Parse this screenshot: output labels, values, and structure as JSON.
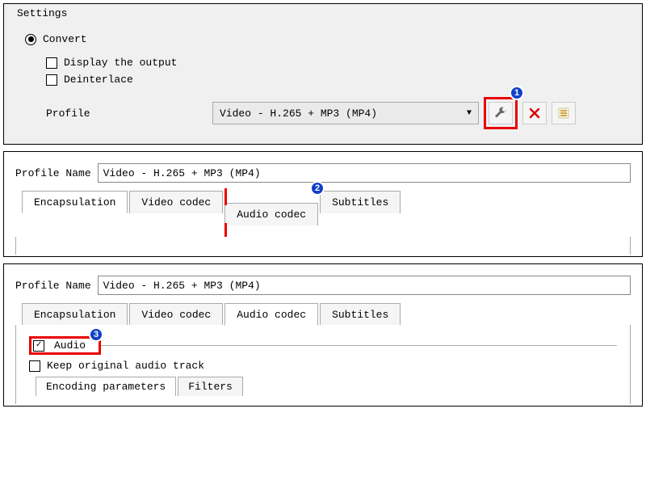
{
  "settings": {
    "legend": "Settings",
    "convert_label": "Convert",
    "display_output_label": "Display the output",
    "deinterlace_label": "Deinterlace",
    "profile_label": "Profile",
    "profile_value": "Video - H.265 + MP3 (MP4)"
  },
  "profile1": {
    "name_label": "Profile Name",
    "name_value": "Video - H.265 + MP3 (MP4)",
    "tabs": {
      "encapsulation": "Encapsulation",
      "video_codec": "Video codec",
      "audio_codec": "Audio codec",
      "subtitles": "Subtitles"
    }
  },
  "profile2": {
    "name_label": "Profile Name",
    "name_value": "Video - H.265 + MP3 (MP4)",
    "tabs": {
      "encapsulation": "Encapsulation",
      "video_codec": "Video codec",
      "audio_codec": "Audio codec",
      "subtitles": "Subtitles"
    },
    "audio_label": "Audio",
    "keep_original_label": "Keep original audio track",
    "subtabs": {
      "encoding": "Encoding parameters",
      "filters": "Filters"
    }
  },
  "badges": {
    "b1": "1",
    "b2": "2",
    "b3": "3"
  },
  "icons": {
    "wrench": "wrench-icon",
    "delete": "delete-icon",
    "list": "list-icon"
  }
}
